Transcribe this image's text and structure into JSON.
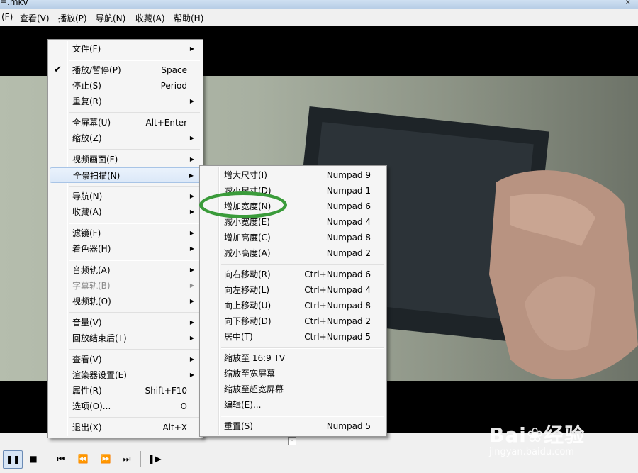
{
  "window": {
    "title": "≡.mkv",
    "close_glyph": "✕"
  },
  "menubar": {
    "items": [
      "(F)",
      "查看(V)",
      "播放(P)",
      "导航(N)",
      "收藏(A)",
      "帮助(H)"
    ]
  },
  "context_menu": {
    "check_glyph": "✔",
    "arrow_glyph": "▶",
    "items": [
      {
        "label": "文件(F)",
        "shortcut": "",
        "submenu": true
      },
      {
        "label": "播放/暂停(P)",
        "shortcut": "Space",
        "checked": true
      },
      {
        "label": "停止(S)",
        "shortcut": "Period"
      },
      {
        "label": "重复(R)",
        "shortcut": "",
        "submenu": true
      },
      {
        "label": "全屏幕(U)",
        "shortcut": "Alt+Enter"
      },
      {
        "label": "缩放(Z)",
        "shortcut": "",
        "submenu": true
      },
      {
        "label": "视频画面(F)",
        "shortcut": "",
        "submenu": true
      },
      {
        "label": "全景扫描(N)",
        "shortcut": "",
        "submenu": true,
        "highlighted": true
      },
      {
        "label": "导航(N)",
        "shortcut": "",
        "submenu": true
      },
      {
        "label": "收藏(A)",
        "shortcut": "",
        "submenu": true
      },
      {
        "label": "滤镜(F)",
        "shortcut": "",
        "submenu": true
      },
      {
        "label": "着色器(H)",
        "shortcut": "",
        "submenu": true
      },
      {
        "label": "音频轨(A)",
        "shortcut": "",
        "submenu": true
      },
      {
        "label": "字幕轨(B)",
        "shortcut": "",
        "submenu": true,
        "disabled": true
      },
      {
        "label": "视频轨(O)",
        "shortcut": "",
        "submenu": true
      },
      {
        "label": "音量(V)",
        "shortcut": "",
        "submenu": true
      },
      {
        "label": "回放结束后(T)",
        "shortcut": "",
        "submenu": true
      },
      {
        "label": "查看(V)",
        "shortcut": "",
        "submenu": true
      },
      {
        "label": "渲染器设置(E)",
        "shortcut": "",
        "submenu": true
      },
      {
        "label": "属性(R)",
        "shortcut": "Shift+F10"
      },
      {
        "label": "选项(O)...",
        "shortcut": "O"
      },
      {
        "label": "退出(X)",
        "shortcut": "Alt+X"
      }
    ]
  },
  "submenu": {
    "items": [
      {
        "label": "增大尺寸(I)",
        "shortcut": "Numpad 9"
      },
      {
        "label": "减小尺寸(D)",
        "shortcut": "Numpad 1"
      },
      {
        "label": "增加宽度(N)",
        "shortcut": "Numpad 6",
        "circled": true
      },
      {
        "label": "减小宽度(E)",
        "shortcut": "Numpad 4"
      },
      {
        "label": "增加高度(C)",
        "shortcut": "Numpad 8"
      },
      {
        "label": "减小高度(A)",
        "shortcut": "Numpad 2"
      },
      {
        "label": "向右移动(R)",
        "shortcut": "Ctrl+Numpad 6"
      },
      {
        "label": "向左移动(L)",
        "shortcut": "Ctrl+Numpad 4"
      },
      {
        "label": "向上移动(U)",
        "shortcut": "Ctrl+Numpad 8"
      },
      {
        "label": "向下移动(D)",
        "shortcut": "Ctrl+Numpad 2"
      },
      {
        "label": "居中(T)",
        "shortcut": "Ctrl+Numpad 5"
      },
      {
        "label": "缩放至 16:9 TV",
        "shortcut": ""
      },
      {
        "label": "缩放至宽屏幕",
        "shortcut": ""
      },
      {
        "label": "缩放至超宽屏幕",
        "shortcut": ""
      },
      {
        "label": "编辑(E)...",
        "shortcut": ""
      },
      {
        "label": "重置(S)",
        "shortcut": "Numpad 5"
      }
    ]
  },
  "controls": {
    "buttons": [
      {
        "name": "pause-button",
        "glyph": "❚❚",
        "pressed": true
      },
      {
        "name": "stop-button",
        "glyph": "■"
      },
      {
        "name": "prev-button",
        "glyph": "⏮"
      },
      {
        "name": "rewind-button",
        "glyph": "⏪"
      },
      {
        "name": "forward-button",
        "glyph": "⏩"
      },
      {
        "name": "next-button",
        "glyph": "⏭"
      },
      {
        "name": "frame-step-button",
        "glyph": "❚▶"
      }
    ],
    "seek_thumb_glyph": "·"
  },
  "watermark": {
    "text": "Bai❀经验",
    "url": "jingyan.baidu.com"
  },
  "colors": {
    "highlight_oval": "#3a9b3a",
    "menu_highlight": "#dbe8f8"
  }
}
